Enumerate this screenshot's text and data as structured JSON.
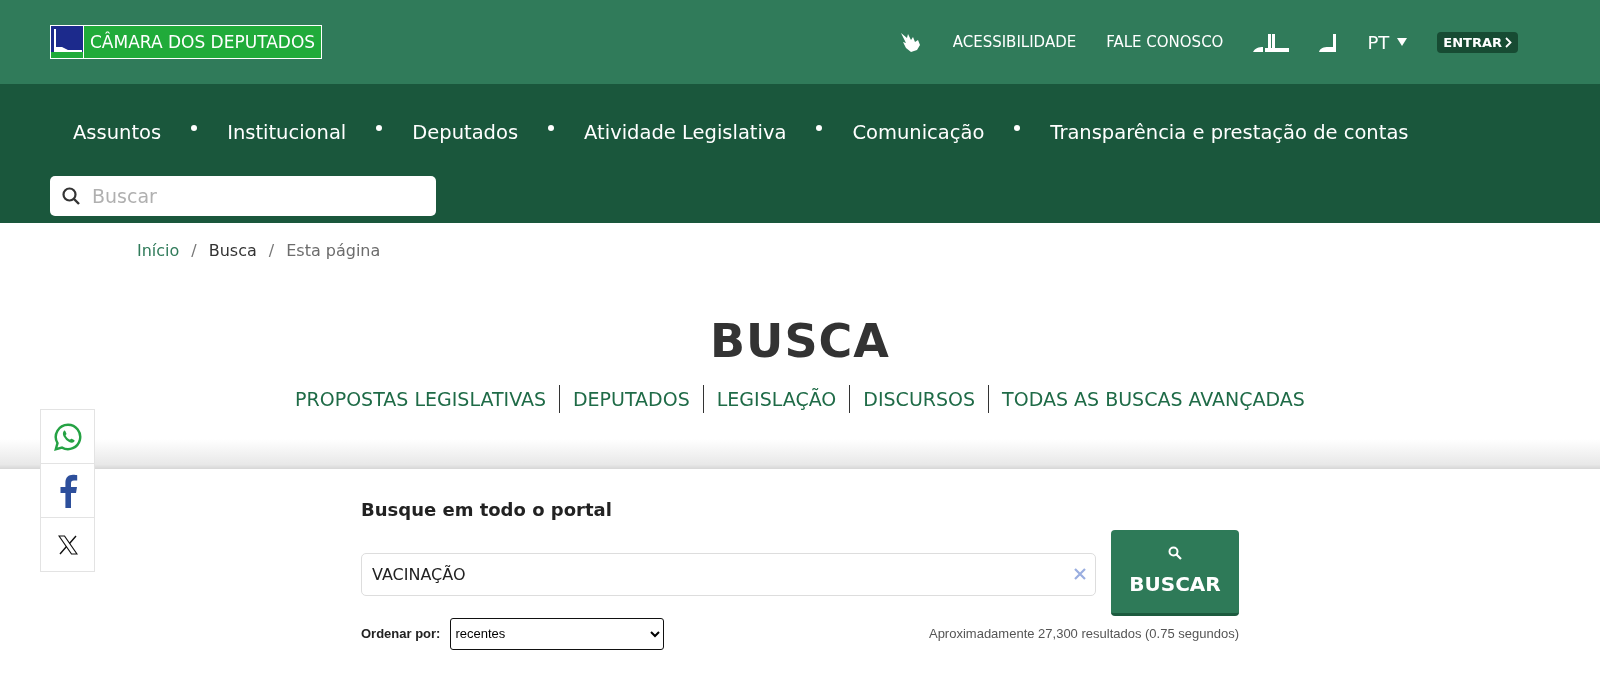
{
  "header": {
    "logo": {
      "text": "CÂMARA DOS DEPUTADOS"
    },
    "links": [
      "ACESSIBILIDADE",
      "FALE CONOSCO"
    ],
    "language": "PT",
    "login": "ENTRAR"
  },
  "nav": {
    "items": [
      "Assuntos",
      "Institucional",
      "Deputados",
      "Atividade Legislativa",
      "Comunicação",
      "Transparência e prestação de contas"
    ],
    "search": {
      "placeholder": "Buscar"
    }
  },
  "breadcrumb": {
    "separator": "/",
    "items": [
      {
        "label": "Início",
        "kind": "link"
      },
      {
        "label": "Busca",
        "kind": "text"
      },
      {
        "label": "Esta página",
        "kind": "muted"
      }
    ]
  },
  "title": "BUSCA",
  "search_types": [
    "PROPOSTAS LEGISLATIVAS",
    "DEPUTADOS",
    "LEGISLAÇÃO",
    "DISCURSOS",
    "TODAS AS BUSCAS AVANÇADAS"
  ],
  "share": [
    {
      "kind": "whatsapp"
    },
    {
      "kind": "facebook"
    },
    {
      "kind": "x"
    }
  ],
  "search_panel": {
    "heading": "Busque em todo o portal",
    "query": "VACINAÇÃO",
    "button": "BUSCAR",
    "sort_label": "Ordenar por:",
    "sort_value": "recentes",
    "results": "Aproximadamente 27,300 resultados (0.75 segundos)"
  }
}
